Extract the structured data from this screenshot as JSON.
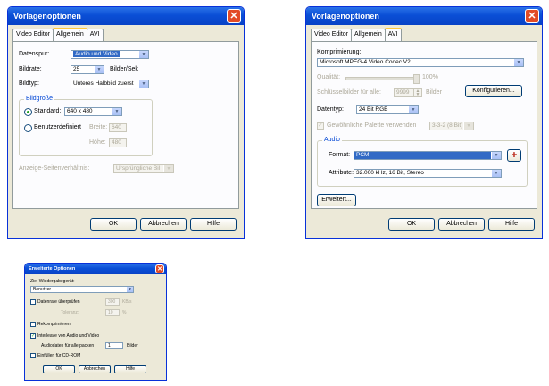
{
  "dialog1": {
    "title": "Vorlagenoptionen",
    "tabs": [
      "Video Editor",
      "Allgemein",
      "AVI"
    ],
    "datenspur_label": "Datenspur:",
    "datenspur_value": "Audio und Video",
    "bildrate_label": "Bildrate:",
    "bildrate_value": "25",
    "bildrate_unit": "Bilder/Sek",
    "bildtyp_label": "Bildtyp:",
    "bildtyp_value": "Unteres Halbbild zuerst",
    "bildgroesse_group": "Bildgröße",
    "standard_label": "Standard:",
    "standard_value": "640 x 480",
    "benutzer_label": "Benutzerdefiniert",
    "breite_label": "Breite:",
    "breite_value": "640",
    "hoehe_label": "Höhe:",
    "hoehe_value": "480",
    "anzeige_label": "Anzeige-Seitenverhältnis:",
    "anzeige_value": "Ursprüngliche Bil",
    "ok": "OK",
    "cancel": "Abbrechen",
    "help": "Hilfe"
  },
  "dialog2": {
    "title": "Vorlagenoptionen",
    "tabs": [
      "Video Editor",
      "Allgemein",
      "AVI"
    ],
    "komprimierung_label": "Komprimierung:",
    "komprimierung_value": "Microsoft MPEG-4 Video Codec V2",
    "qualitaet_label": "Qualität:",
    "qualitaet_value": "100%",
    "schluessel_label": "Schlüsselbilder für alle:",
    "schluessel_value": "9999",
    "schluessel_unit": "Bilder",
    "konfigurieren": "Konfigurieren...",
    "datentyp_label": "Datentyp:",
    "datentyp_value": "24 Bit RGB",
    "palette_label": "Gewöhnliche Palette verwenden",
    "palette_value": "3-3-2 (8 Bit)",
    "audio_group": "Audio",
    "format_label": "Format:",
    "format_value": "PCM",
    "attribute_label": "Attribute:",
    "attribute_value": "32.000 kHz, 16 Bit, Stereo",
    "erweitert": "Erweitert...",
    "ok": "OK",
    "cancel": "Abbrechen",
    "help": "Hilfe"
  },
  "dialog3": {
    "title": "Erweiterte Optionen",
    "ziel_label": "Ziel-Wiedergabegerät:",
    "ziel_value": "Benutzer",
    "datenrate_label": "Datenrate überprüfen",
    "datenrate_value": "300",
    "datenrate_unit": "KB/s",
    "toleranz_label": "Toleranz:",
    "toleranz_value": "10",
    "toleranz_unit": "%",
    "rekomp_label": "Rekomprimieren",
    "interleave_label": "Interleave von Audio und Video",
    "audio_pack_label": "Audiodaten für alle packen",
    "audio_pack_value": "1",
    "audio_pack_unit": "Bilder",
    "cdrom_label": "Einfüllen für CD-ROM",
    "ok": "OK",
    "cancel": "Abbrechen",
    "help": "Hilfe"
  }
}
